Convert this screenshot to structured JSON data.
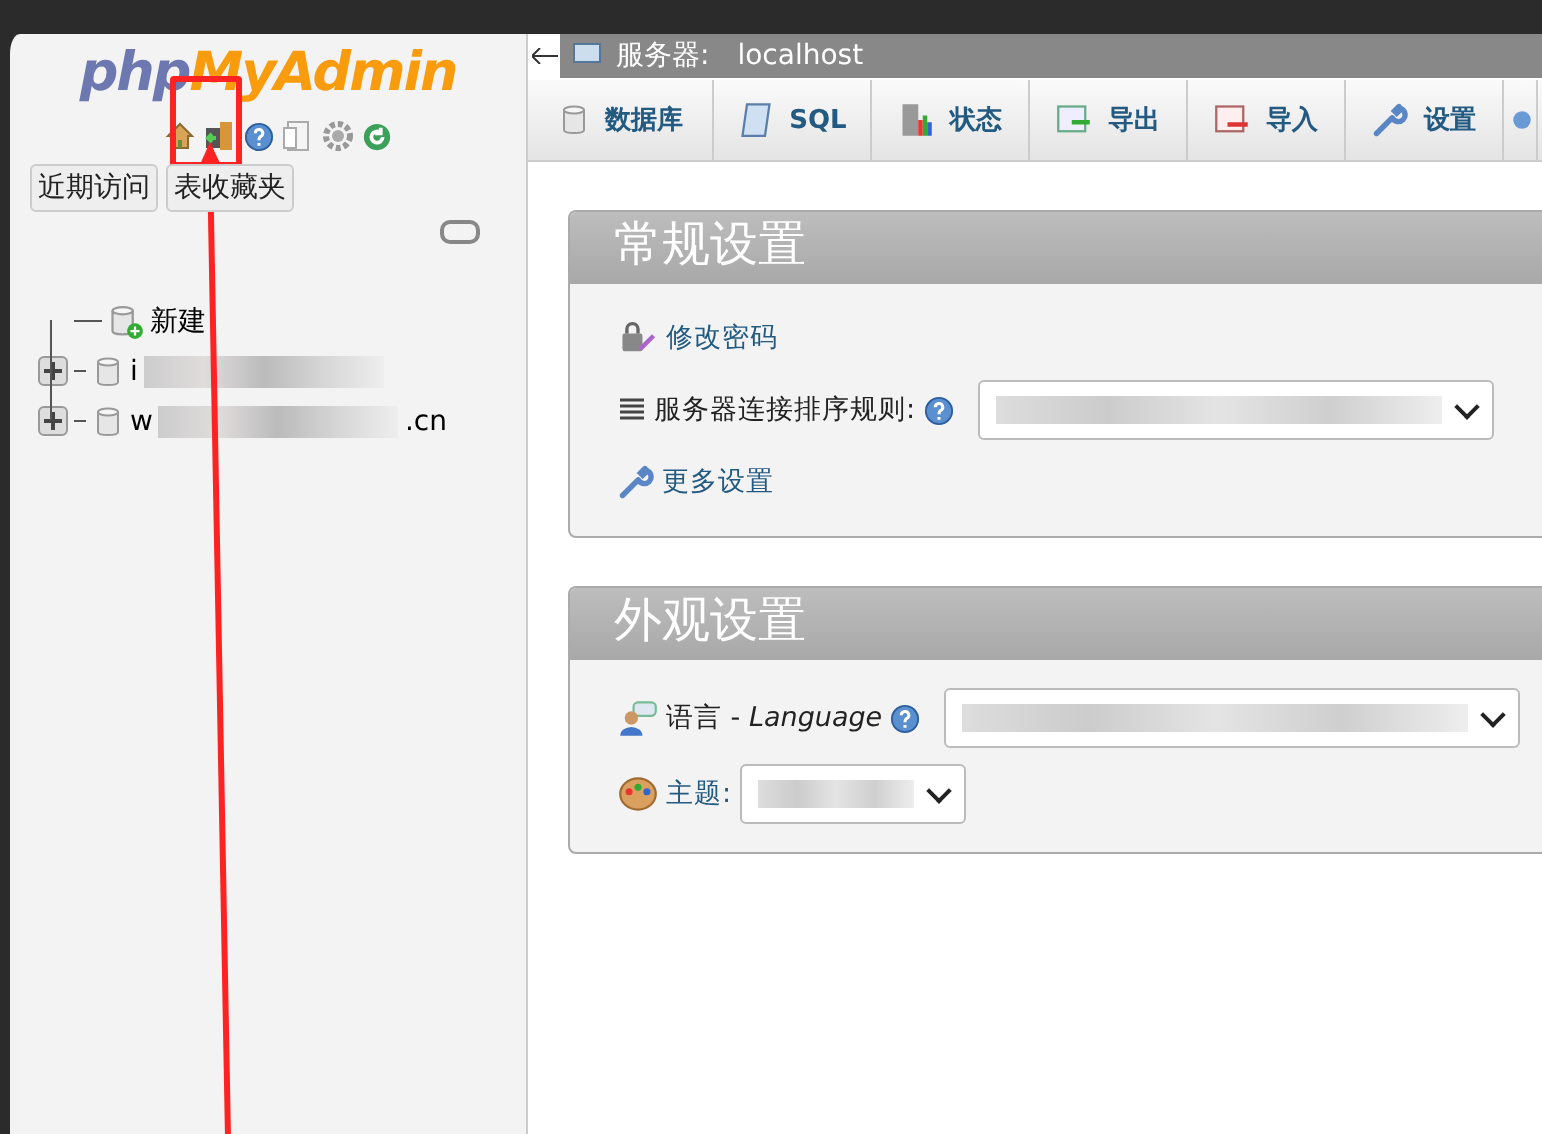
{
  "annotation": {
    "kind": "highlight-arrow"
  },
  "sidebar": {
    "logo_parts": [
      {
        "text": "php",
        "color": "#6c78af"
      },
      {
        "text": "MyAdmin",
        "color": "#f89c0e"
      }
    ],
    "nav_icons": [
      {
        "kind": "home"
      },
      {
        "kind": "exit"
      },
      {
        "kind": "help"
      },
      {
        "kind": "docs"
      },
      {
        "kind": "settings"
      },
      {
        "kind": "reload"
      }
    ],
    "buttons": [
      "近期访问",
      "表收藏夹"
    ],
    "tree": [
      {
        "kind": "new",
        "label": "新建"
      },
      {
        "kind": "db",
        "label_start": "i"
      },
      {
        "kind": "db",
        "label_start": "w",
        "label_end": ".cn"
      }
    ]
  },
  "main": {
    "breadcrumb": {
      "label": "服务器:",
      "value": "localhost"
    },
    "tabs": [
      {
        "label": "数据库",
        "selected": false
      },
      {
        "label": "SQL",
        "selected": false
      },
      {
        "label": "状态",
        "selected": false
      },
      {
        "label": "导出",
        "selected": false
      },
      {
        "label": "导入",
        "selected": false
      },
      {
        "label": "设置",
        "selected": false
      },
      {
        "selected": false
      }
    ],
    "panels": [
      {
        "title": "常规设置",
        "rows": [
          {
            "kind": "password",
            "label": "修改密码"
          },
          {
            "kind": "collation",
            "label": "服务器连接排序规则:"
          },
          {
            "kind": "more",
            "label": "更多设置"
          }
        ]
      },
      {
        "title": "外观设置",
        "rows": [
          {
            "kind": "language",
            "label": "语言 - ",
            "label_em": "Language"
          },
          {
            "kind": "theme",
            "label": "主题:"
          }
        ]
      }
    ]
  }
}
